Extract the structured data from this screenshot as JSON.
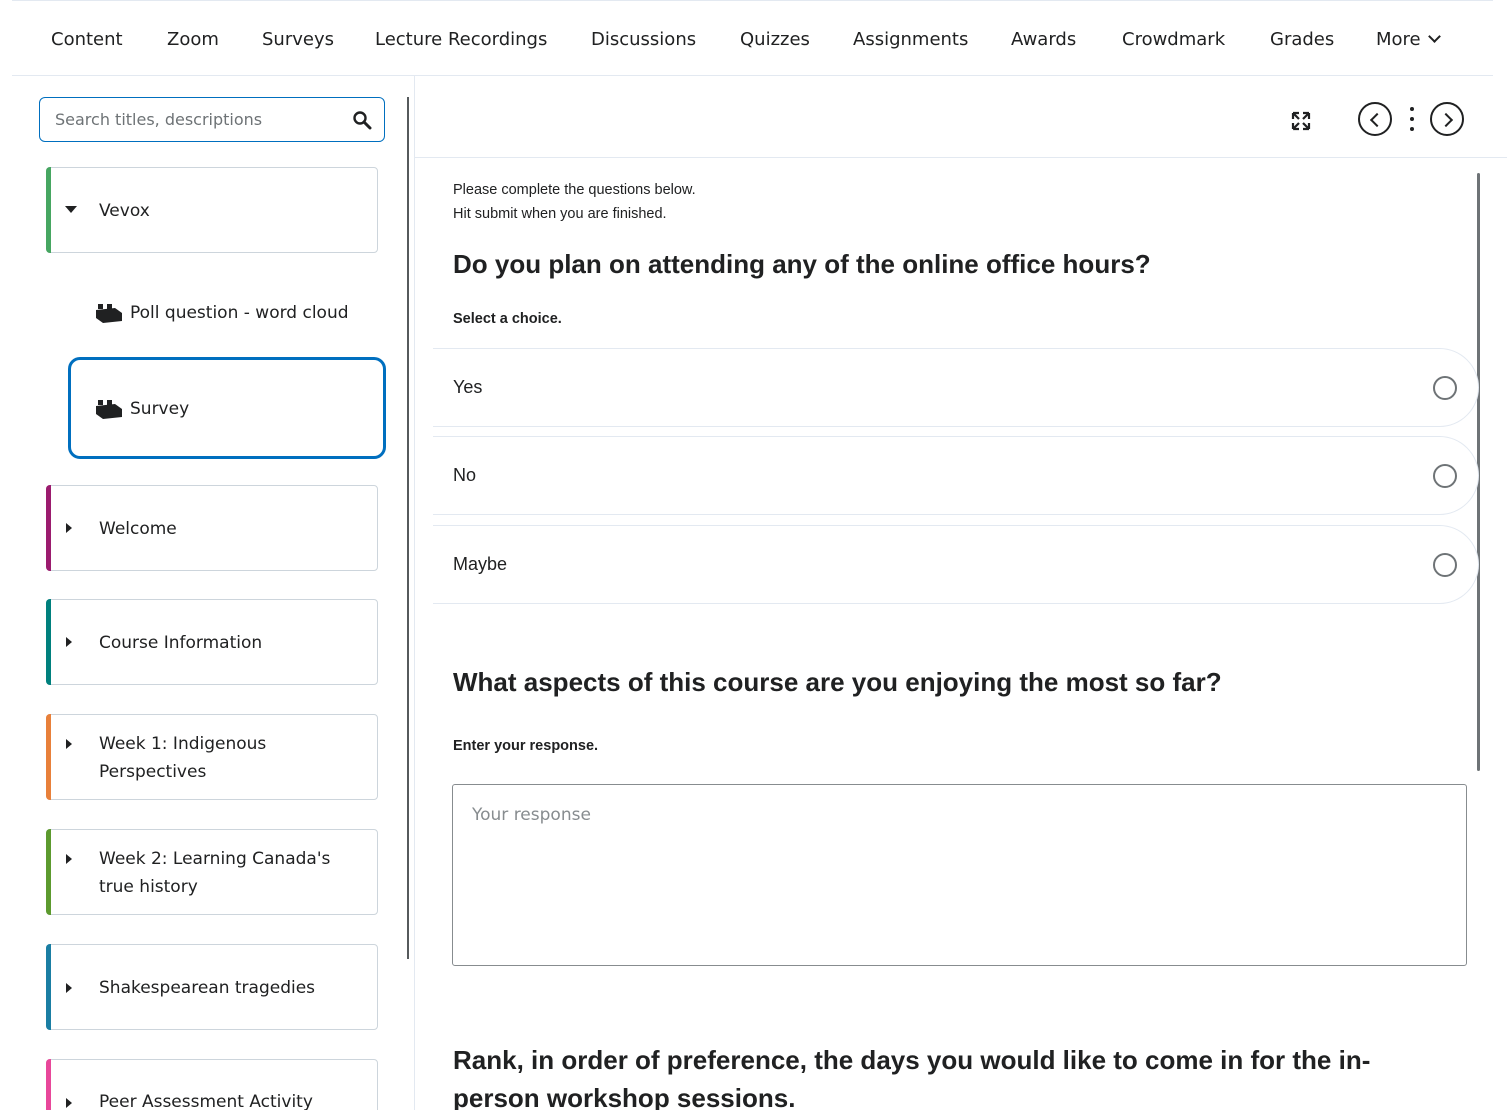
{
  "nav": {
    "items": [
      "Content",
      "Zoom",
      "Surveys",
      "Lecture Recordings",
      "Discussions",
      "Quizzes",
      "Assignments",
      "Awards",
      "Crowdmark",
      "Grades"
    ],
    "more_label": "More"
  },
  "sidebar": {
    "search_placeholder": "Search titles, descriptions",
    "modules": [
      {
        "label": "Vevox",
        "color": "#46a661",
        "expanded": true
      },
      {
        "label": "Welcome",
        "color": "#9b1b6e",
        "expanded": false
      },
      {
        "label": "Course Information",
        "color": "#00807d",
        "expanded": false
      },
      {
        "label": "Week 1: Indigenous Perspectives",
        "color": "#e8803a",
        "expanded": false
      },
      {
        "label": "Week 2: Learning Canada's true history",
        "color": "#5c9a2e",
        "expanded": false
      },
      {
        "label": "Shakespearean tragedies",
        "color": "#1a7ea3",
        "expanded": false
      },
      {
        "label": "Peer Assessment Activity",
        "color": "#e8479a",
        "expanded": false
      }
    ],
    "topics": [
      {
        "label": "Poll question - word cloud",
        "icon": "lego-brick-icon",
        "selected": false
      },
      {
        "label": "Survey",
        "icon": "lego-brick-icon",
        "selected": true
      }
    ]
  },
  "content": {
    "intro_line1": "Please complete the questions below.",
    "intro_line2": "Hit submit when you are finished.",
    "questions": [
      {
        "title": "Do you plan on attending any of the online office hours?",
        "instruction": "Select a choice.",
        "choices": [
          "Yes",
          "No",
          "Maybe"
        ]
      },
      {
        "title": "What aspects of this course are you enjoying the most so far?",
        "instruction": "Enter your response.",
        "placeholder": "Your response"
      },
      {
        "title": "Rank, in order of preference, the days you would like to come in for the in-person workshop sessions."
      }
    ]
  },
  "colors": {
    "accent": "#006fbf",
    "text": "#202122",
    "border": "#e3e9f1"
  }
}
